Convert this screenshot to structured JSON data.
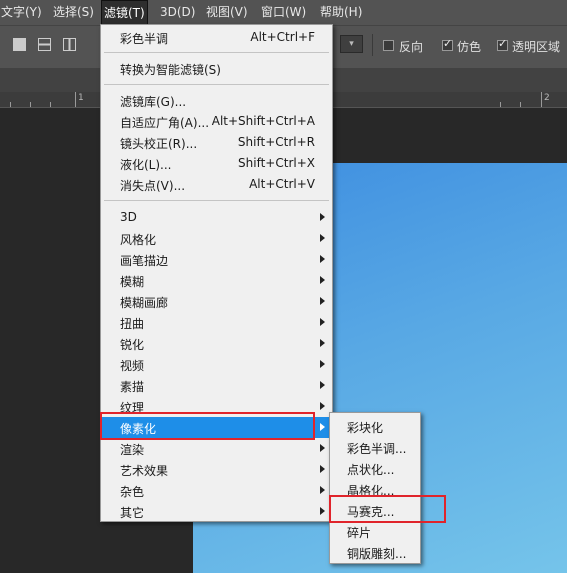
{
  "menubar": {
    "items": [
      {
        "label": "文字(Y)"
      },
      {
        "label": "选择(S)"
      },
      {
        "label": "滤镜(T)"
      },
      {
        "label": "3D(D)"
      },
      {
        "label": "视图(V)"
      },
      {
        "label": "窗口(W)"
      },
      {
        "label": "帮助(H)"
      }
    ]
  },
  "options": {
    "reverse_label": "反向",
    "dither_label": "仿色",
    "transparency_label": "透明区域",
    "reverse_checked": false,
    "dither_checked": true,
    "transparency_checked": true
  },
  "ruler": {
    "labels": [
      "1",
      "2"
    ]
  },
  "filter_menu": {
    "top_items": [
      {
        "label": "彩色半调",
        "shortcut": "Alt+Ctrl+F"
      },
      {
        "label": "转换为智能滤镜(S)",
        "shortcut": ""
      }
    ],
    "gallery_items": [
      {
        "label": "滤镜库(G)...",
        "shortcut": ""
      },
      {
        "label": "自适应广角(A)...",
        "shortcut": "Alt+Shift+Ctrl+A"
      },
      {
        "label": "镜头校正(R)...",
        "shortcut": "Shift+Ctrl+R"
      },
      {
        "label": "液化(L)...",
        "shortcut": "Shift+Ctrl+X"
      },
      {
        "label": "消失点(V)...",
        "shortcut": "Alt+Ctrl+V"
      }
    ],
    "submenus": [
      {
        "label": "3D"
      },
      {
        "label": "风格化"
      },
      {
        "label": "画笔描边"
      },
      {
        "label": "模糊"
      },
      {
        "label": "模糊画廊"
      },
      {
        "label": "扭曲"
      },
      {
        "label": "锐化"
      },
      {
        "label": "视频"
      },
      {
        "label": "素描"
      },
      {
        "label": "纹理"
      },
      {
        "label": "像素化"
      },
      {
        "label": "渲染"
      },
      {
        "label": "艺术效果"
      },
      {
        "label": "杂色"
      },
      {
        "label": "其它"
      }
    ]
  },
  "pixelate_submenu": {
    "items": [
      {
        "label": "彩块化"
      },
      {
        "label": "彩色半调..."
      },
      {
        "label": "点状化..."
      },
      {
        "label": "晶格化..."
      },
      {
        "label": "马赛克..."
      },
      {
        "label": "碎片"
      },
      {
        "label": "铜版雕刻..."
      }
    ]
  },
  "colors": {
    "highlight": "#1e8ee8",
    "annotation_box": "#e0242b",
    "menu_bg": "#f0f0f0",
    "app_bg": "#535353"
  }
}
